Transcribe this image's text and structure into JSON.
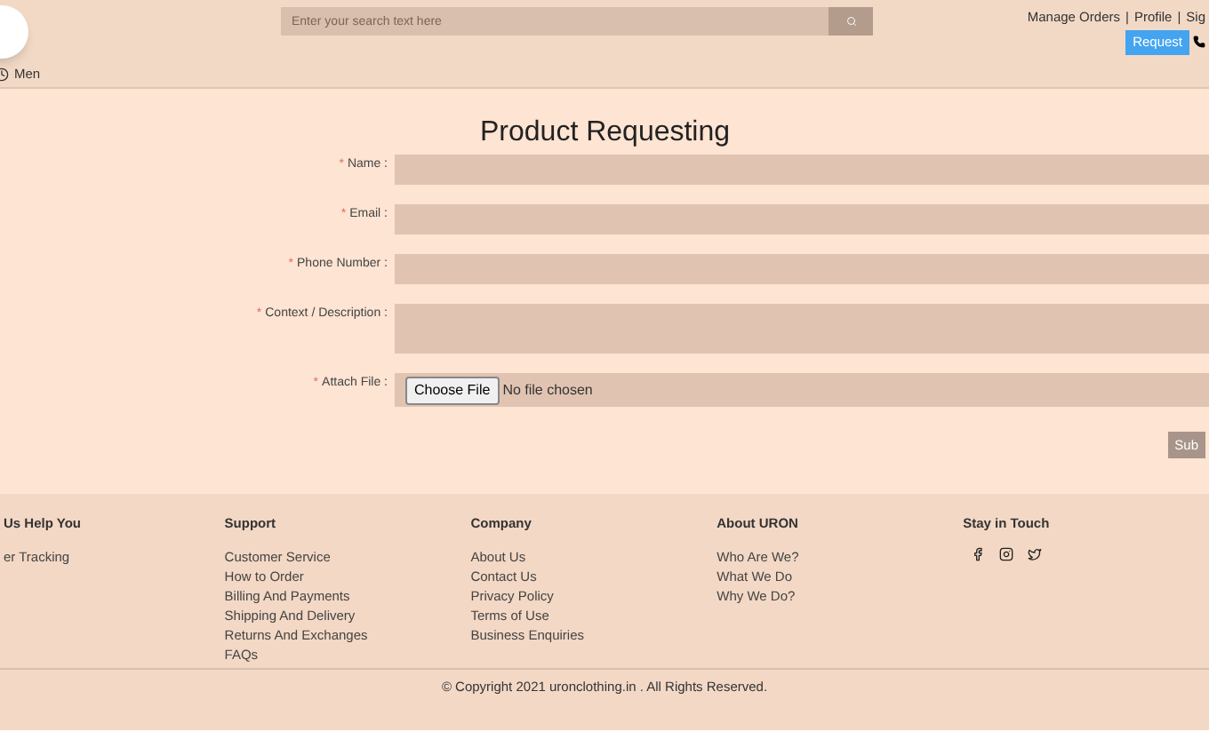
{
  "header": {
    "search": {
      "placeholder": "Enter your search text here"
    },
    "nav_links": [
      "Manage Orders",
      "Profile",
      "Sig"
    ],
    "nav_separator": "|",
    "request_button": "Request",
    "category": "Men"
  },
  "form": {
    "title": "Product Requesting",
    "required_mark": "*",
    "fields": [
      {
        "label": "Name :",
        "kind": "input",
        "required": true
      },
      {
        "label": "Email :",
        "kind": "input",
        "required": true
      },
      {
        "label": "Phone Number :",
        "kind": "input",
        "required": true
      },
      {
        "label": "Context / Description :",
        "kind": "textarea",
        "required": true
      },
      {
        "label": "Attach File :",
        "kind": "file",
        "required": true,
        "button": "Choose File",
        "status": "No file chosen"
      }
    ],
    "submit": "Sub"
  },
  "footer": {
    "columns": [
      {
        "title": "Us Help You",
        "links": [
          "er Tracking"
        ]
      },
      {
        "title": "Support",
        "links": [
          "Customer Service",
          "How to Order",
          "Billing And Payments",
          "Shipping And Delivery",
          "Returns And Exchanges",
          "FAQs"
        ]
      },
      {
        "title": "Company",
        "links": [
          "About Us",
          "Contact Us",
          "Privacy Policy",
          "Terms of Use",
          "Business Enquiries"
        ]
      },
      {
        "title": "About URON",
        "links": [
          "Who Are We?",
          "What We Do",
          "Why We Do?"
        ]
      },
      {
        "title": "Stay in Touch",
        "kind": "social"
      }
    ],
    "copyright": "© Copyright 2021 uronclothing.in . All Rights Reserved."
  }
}
